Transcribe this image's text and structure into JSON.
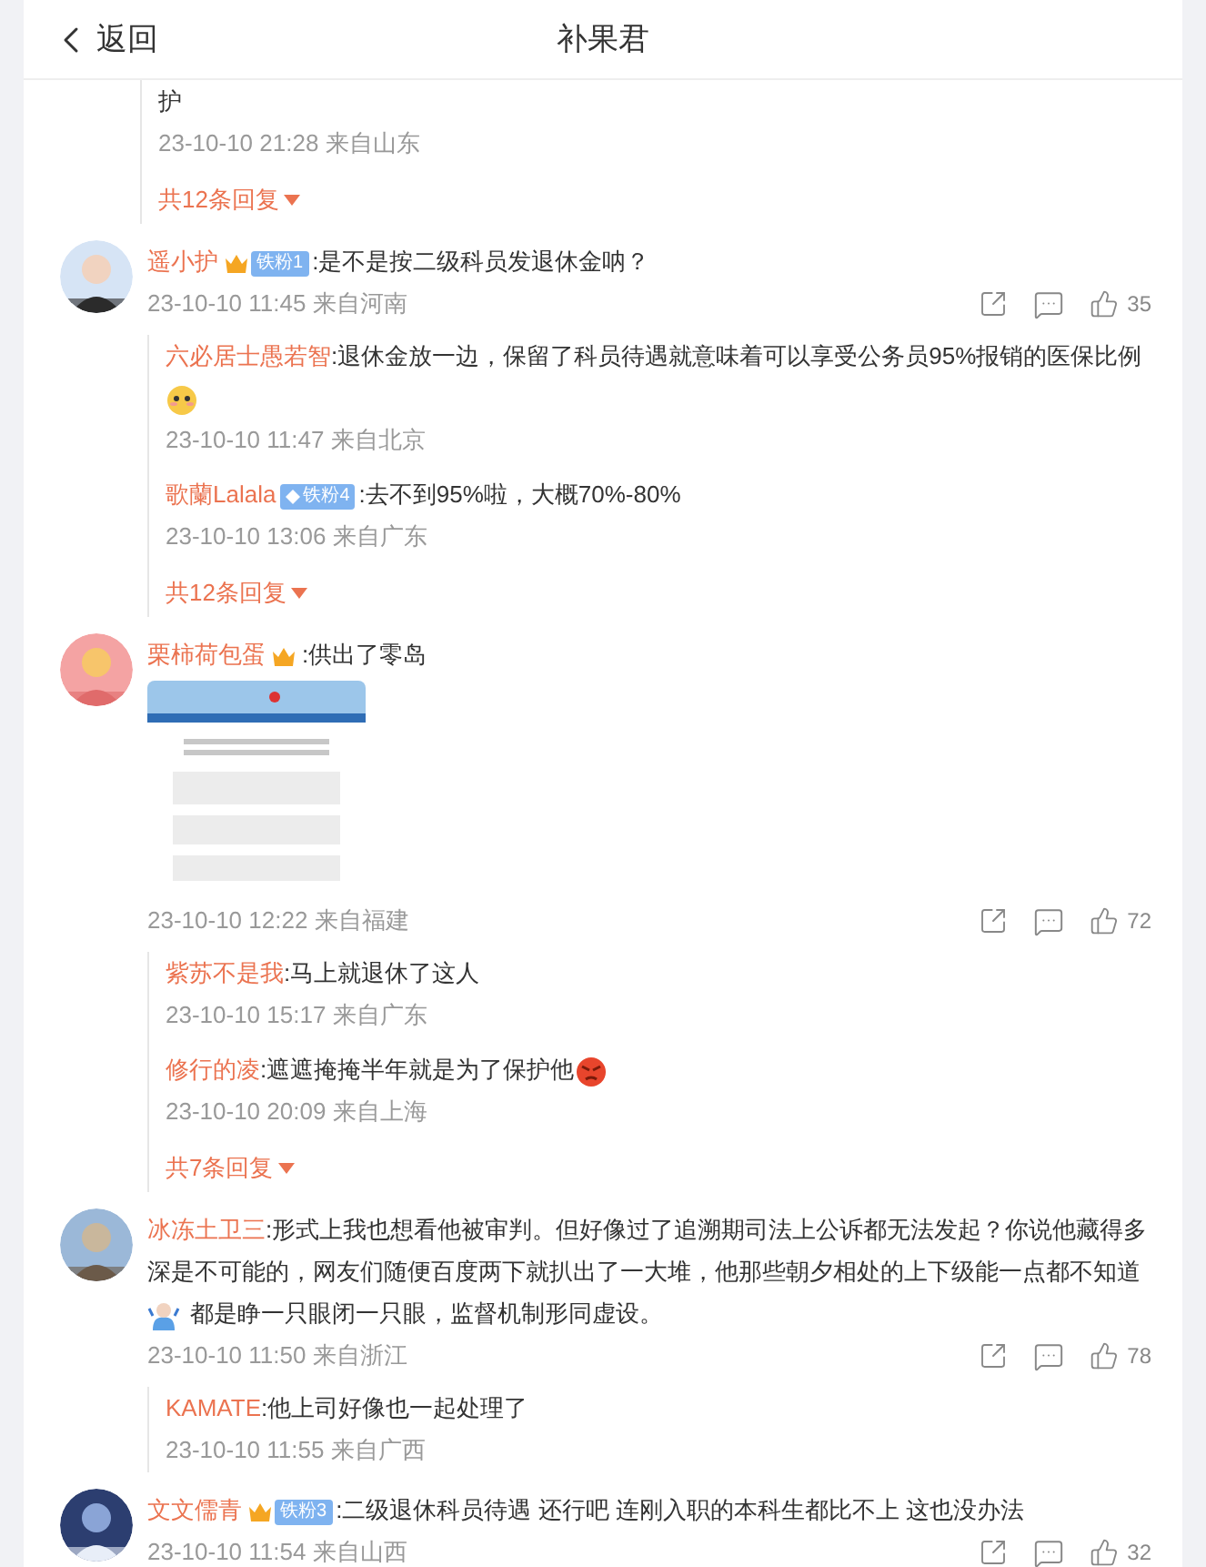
{
  "header": {
    "back": "返回",
    "title": "补果君"
  },
  "top_thread": {
    "replies": [
      {
        "segments": [
          {
            "kind": "text",
            "text": "护"
          }
        ],
        "time": "23-10-10 21:28 来自山东"
      }
    ],
    "more": "共12条回复"
  },
  "comments": [
    {
      "avatar": {
        "kind": "picture"
      },
      "name": "遥小护",
      "badge": {
        "kind": "crown",
        "label": "铁粉1"
      },
      "segments": [
        {
          "kind": "text",
          "text": ":是不是按二级科员发退休金呐？"
        }
      ],
      "time": "23-10-10 11:45 来自河南",
      "likes": "35",
      "replies": [
        {
          "name": "六必居士愚若智",
          "segments": [
            {
              "kind": "text",
              "text": ":退休金放一边，保留了科员待遇就意味着可以享受公务员95%报销的医保比例"
            },
            {
              "kind": "blush"
            }
          ],
          "time": "23-10-10 11:47 来自北京"
        },
        {
          "name": "歌蘭Lalala",
          "badge": {
            "kind": "diamond",
            "label": "铁粉4"
          },
          "segments": [
            {
              "kind": "text",
              "text": ":去不到95%啦，大概70%-80%"
            }
          ],
          "time": "23-10-10 13:06 来自广东"
        }
      ],
      "more": "共12条回复"
    },
    {
      "avatar": {
        "kind": "picture"
      },
      "name": "栗柿荷包蛋",
      "badge": {
        "kind": "crown"
      },
      "segments": [
        {
          "kind": "text",
          "text": ":供出了零岛"
        }
      ],
      "image": {
        "kind": "picture"
      },
      "time": "23-10-10 12:22 来自福建",
      "likes": "72",
      "replies": [
        {
          "name": "紫苏不是我",
          "segments": [
            {
              "kind": "text",
              "text": ":马上就退休了这人"
            }
          ],
          "time": "23-10-10 15:17 来自广东"
        },
        {
          "name": "修行的凌",
          "segments": [
            {
              "kind": "text",
              "text": ":遮遮掩掩半年就是为了保护他"
            },
            {
              "kind": "angry"
            }
          ],
          "time": "23-10-10 20:09 来自上海"
        }
      ],
      "more": "共7条回复"
    },
    {
      "avatar": {
        "kind": "picture"
      },
      "name": "冰冻土卫三",
      "segments": [
        {
          "kind": "text",
          "text": ":形式上我也想看他被审判。但好像过了追溯期司法上公诉都无法发起？你说他藏得多深是不可能的，网友们随便百度两下就扒出了一大堆，他那些朝夕相处的上下级能一点都不知道"
        },
        {
          "kind": "shrug"
        },
        {
          "kind": "text",
          "text": " 都是睁一只眼闭一只眼，监督机制形同虚设。"
        }
      ],
      "time": "23-10-10 11:50 来自浙江",
      "likes": "78",
      "replies": [
        {
          "name": "KAMATE",
          "segments": [
            {
              "kind": "text",
              "text": ":他上司好像也一起处理了"
            }
          ],
          "time": "23-10-10 11:55 来自广西"
        }
      ]
    },
    {
      "avatar": {
        "kind": "picture"
      },
      "name": "文文儒青",
      "badge": {
        "kind": "crown",
        "label": "铁粉3"
      },
      "segments": [
        {
          "kind": "text",
          "text": ":二级退休科员待遇  还行吧  连刚入职的本科生都比不上  这也没办法"
        }
      ],
      "time": "23-10-10 11:54 来自山西",
      "likes": "32"
    }
  ]
}
